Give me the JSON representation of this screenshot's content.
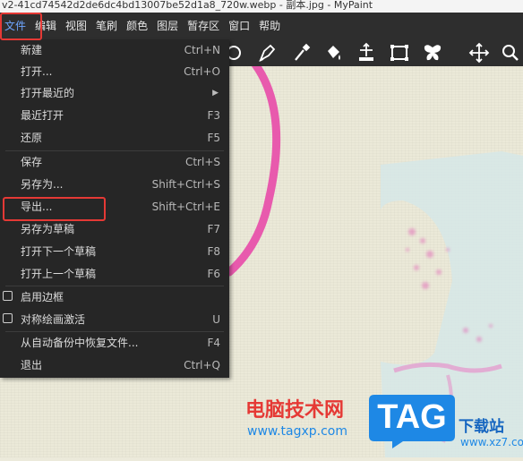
{
  "window": {
    "title": "v2-41cd74542d2de6dc4bd13007be52d1a8_720w.webp - 副本.jpg - MyPaint"
  },
  "menubar": {
    "items": [
      "文件",
      "编辑",
      "视图",
      "笔刷",
      "颜色",
      "图层",
      "暂存区",
      "窗口",
      "帮助"
    ]
  },
  "toolbar": {
    "tools": [
      "ellipse-tool-icon",
      "ink-pen-icon",
      "color-picker-icon",
      "fill-bucket-icon",
      "move-layer-icon",
      "frame-icon",
      "symmetry-icon",
      "pan-icon",
      "zoom-icon"
    ]
  },
  "file_menu": {
    "items": [
      {
        "label": "新建",
        "shortcut": "Ctrl+N"
      },
      {
        "label": "打开...",
        "shortcut": "Ctrl+O"
      },
      {
        "label": "打开最近的",
        "shortcut": ""
      },
      {
        "label": "最近打开",
        "shortcut": "F3"
      },
      {
        "label": "还原",
        "shortcut": "F5"
      },
      {
        "label": "保存",
        "shortcut": "Ctrl+S"
      },
      {
        "label": "另存为...",
        "shortcut": "Shift+Ctrl+S"
      },
      {
        "label": "导出...",
        "shortcut": "Shift+Ctrl+E"
      },
      {
        "label": "另存为草稿",
        "shortcut": "F7"
      },
      {
        "label": "打开下一个草稿",
        "shortcut": "F8"
      },
      {
        "label": "打开上一个草稿",
        "shortcut": "F6"
      },
      {
        "label": "启用边框",
        "shortcut": ""
      },
      {
        "label": "对称绘画激活",
        "shortcut": "U"
      },
      {
        "label": "从自动备份中恢复文件...",
        "shortcut": "F4"
      },
      {
        "label": "退出",
        "shortcut": "Ctrl+Q"
      }
    ]
  },
  "watermark": {
    "site_name": "电脑技术网",
    "site_url": "www.tagxp.com",
    "logo_text": "TAG",
    "right_name": "下载站",
    "right_url": "www.xz7.com"
  },
  "colors": {
    "menu_bg": "#262626",
    "menubar_bg": "#2e2e2e",
    "highlight": "#e53935",
    "pink_stroke": "#e84aa8",
    "tag_blue": "#1e88e5"
  }
}
